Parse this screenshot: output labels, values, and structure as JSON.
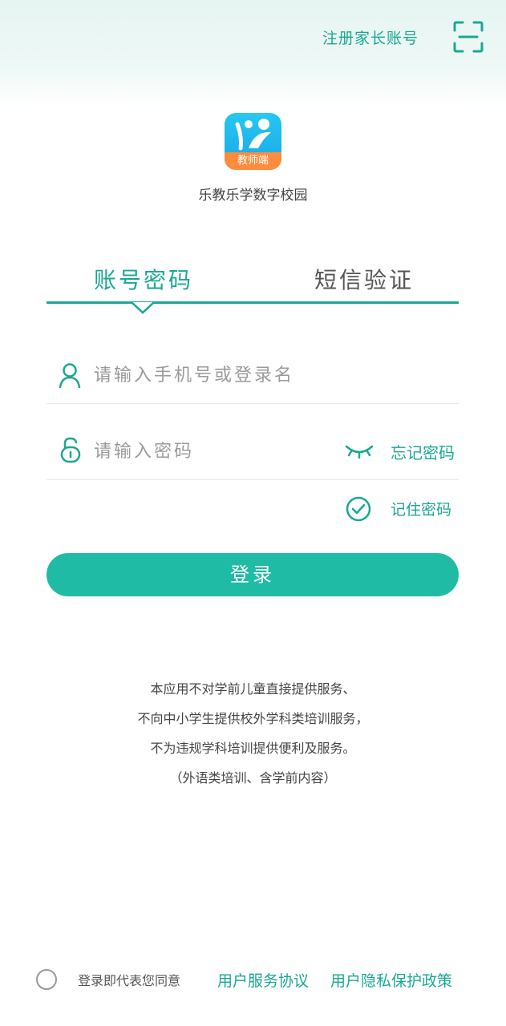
{
  "header": {
    "register_parent": "注册家长账号",
    "scan_icon": "scan-icon"
  },
  "app": {
    "logo_badge": "教师端",
    "name": "乐教乐学数字校园"
  },
  "tabs": {
    "account": "账号密码",
    "sms": "短信验证"
  },
  "form": {
    "username_placeholder": "请输入手机号或登录名",
    "password_placeholder": "请输入密码",
    "forgot": "忘记密码",
    "remember": "记住密码",
    "login_button": "登录"
  },
  "notice": [
    "本应用不对学前儿童直接提供服务、",
    "不向中小学生提供校外学科类培训服务，",
    "不为违规学科培训提供便利及服务。",
    "（外语类培训、含学前内容）"
  ],
  "agreement": {
    "text": "登录即代表您同意",
    "service": "用户服务协议",
    "privacy": "用户隐私保护政策"
  },
  "colors": {
    "accent": "#1aa892",
    "button": "#20bba5",
    "badge": "#ff8b3d"
  }
}
